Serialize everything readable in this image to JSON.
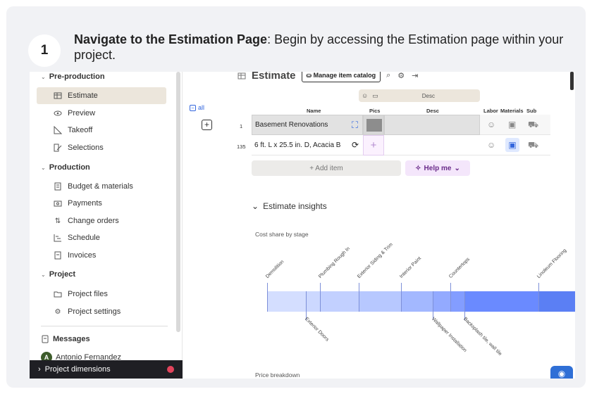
{
  "step": {
    "number": "1",
    "title": "Navigate to the Estimation Page",
    "text": ": Begin by accessing the Estimation page within your project."
  },
  "sidebar": {
    "sections": [
      {
        "label": "Pre-production",
        "items": [
          "Estimate",
          "Preview",
          "Takeoff",
          "Selections"
        ]
      },
      {
        "label": "Production",
        "items": [
          "Budget & materials",
          "Payments",
          "Change orders",
          "Schedule",
          "Invoices"
        ]
      },
      {
        "label": "Project",
        "items": [
          "Project files",
          "Project settings"
        ]
      }
    ],
    "messages": "Messages",
    "user": "Antonio Fernandez",
    "user_initial": "A",
    "footer": "Project dimensions"
  },
  "header": {
    "title": "Estimate",
    "manage_catalog": "Manage item catalog"
  },
  "table": {
    "group_desc": "Desc",
    "all": "all",
    "columns": [
      "Name",
      "Pics",
      "Desc",
      "Labor",
      "Materials",
      "Sub"
    ],
    "rows": [
      {
        "num": "1",
        "name": "Basement Renovations"
      },
      {
        "num": "135",
        "name": "6 ft. L x 25.5 in. D, Acacia B"
      }
    ],
    "add_item": "+ Add item",
    "help": "Help me"
  },
  "insights": {
    "title": "Estimate insights",
    "cost_share_label": "Cost share by stage",
    "price_breakdown_label": "Price breakdown"
  },
  "chart_data": {
    "type": "bar",
    "title": "Cost share by stage",
    "categories": [
      "Demolition",
      "Exterior Doors",
      "Plumbing Rough In",
      "Exterior Siding & Trim",
      "Interior Paint",
      "Wallpaper Installation",
      "Countertops",
      "Backsplash tile, wall tile",
      "Linoleum Flooring"
    ],
    "values": [
      11,
      4,
      11,
      12,
      9,
      5,
      4,
      21,
      11
    ],
    "colors": [
      "#d4deff",
      "#ccd8ff",
      "#c2d0ff",
      "#b7c8ff",
      "#a3b8ff",
      "#93aaff",
      "#839dff",
      "#6a8aff",
      "#5b7ff4"
    ]
  }
}
